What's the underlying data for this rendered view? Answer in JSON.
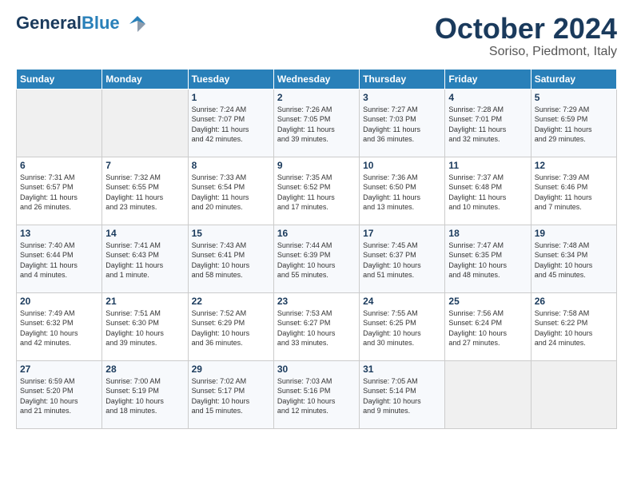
{
  "logo": {
    "line1": "General",
    "line2": "Blue"
  },
  "header": {
    "month": "October 2024",
    "location": "Soriso, Piedmont, Italy"
  },
  "weekdays": [
    "Sunday",
    "Monday",
    "Tuesday",
    "Wednesday",
    "Thursday",
    "Friday",
    "Saturday"
  ],
  "weeks": [
    [
      {
        "day": "",
        "content": ""
      },
      {
        "day": "",
        "content": ""
      },
      {
        "day": "1",
        "content": "Sunrise: 7:24 AM\nSunset: 7:07 PM\nDaylight: 11 hours\nand 42 minutes."
      },
      {
        "day": "2",
        "content": "Sunrise: 7:26 AM\nSunset: 7:05 PM\nDaylight: 11 hours\nand 39 minutes."
      },
      {
        "day": "3",
        "content": "Sunrise: 7:27 AM\nSunset: 7:03 PM\nDaylight: 11 hours\nand 36 minutes."
      },
      {
        "day": "4",
        "content": "Sunrise: 7:28 AM\nSunset: 7:01 PM\nDaylight: 11 hours\nand 32 minutes."
      },
      {
        "day": "5",
        "content": "Sunrise: 7:29 AM\nSunset: 6:59 PM\nDaylight: 11 hours\nand 29 minutes."
      }
    ],
    [
      {
        "day": "6",
        "content": "Sunrise: 7:31 AM\nSunset: 6:57 PM\nDaylight: 11 hours\nand 26 minutes."
      },
      {
        "day": "7",
        "content": "Sunrise: 7:32 AM\nSunset: 6:55 PM\nDaylight: 11 hours\nand 23 minutes."
      },
      {
        "day": "8",
        "content": "Sunrise: 7:33 AM\nSunset: 6:54 PM\nDaylight: 11 hours\nand 20 minutes."
      },
      {
        "day": "9",
        "content": "Sunrise: 7:35 AM\nSunset: 6:52 PM\nDaylight: 11 hours\nand 17 minutes."
      },
      {
        "day": "10",
        "content": "Sunrise: 7:36 AM\nSunset: 6:50 PM\nDaylight: 11 hours\nand 13 minutes."
      },
      {
        "day": "11",
        "content": "Sunrise: 7:37 AM\nSunset: 6:48 PM\nDaylight: 11 hours\nand 10 minutes."
      },
      {
        "day": "12",
        "content": "Sunrise: 7:39 AM\nSunset: 6:46 PM\nDaylight: 11 hours\nand 7 minutes."
      }
    ],
    [
      {
        "day": "13",
        "content": "Sunrise: 7:40 AM\nSunset: 6:44 PM\nDaylight: 11 hours\nand 4 minutes."
      },
      {
        "day": "14",
        "content": "Sunrise: 7:41 AM\nSunset: 6:43 PM\nDaylight: 11 hours\nand 1 minute."
      },
      {
        "day": "15",
        "content": "Sunrise: 7:43 AM\nSunset: 6:41 PM\nDaylight: 10 hours\nand 58 minutes."
      },
      {
        "day": "16",
        "content": "Sunrise: 7:44 AM\nSunset: 6:39 PM\nDaylight: 10 hours\nand 55 minutes."
      },
      {
        "day": "17",
        "content": "Sunrise: 7:45 AM\nSunset: 6:37 PM\nDaylight: 10 hours\nand 51 minutes."
      },
      {
        "day": "18",
        "content": "Sunrise: 7:47 AM\nSunset: 6:35 PM\nDaylight: 10 hours\nand 48 minutes."
      },
      {
        "day": "19",
        "content": "Sunrise: 7:48 AM\nSunset: 6:34 PM\nDaylight: 10 hours\nand 45 minutes."
      }
    ],
    [
      {
        "day": "20",
        "content": "Sunrise: 7:49 AM\nSunset: 6:32 PM\nDaylight: 10 hours\nand 42 minutes."
      },
      {
        "day": "21",
        "content": "Sunrise: 7:51 AM\nSunset: 6:30 PM\nDaylight: 10 hours\nand 39 minutes."
      },
      {
        "day": "22",
        "content": "Sunrise: 7:52 AM\nSunset: 6:29 PM\nDaylight: 10 hours\nand 36 minutes."
      },
      {
        "day": "23",
        "content": "Sunrise: 7:53 AM\nSunset: 6:27 PM\nDaylight: 10 hours\nand 33 minutes."
      },
      {
        "day": "24",
        "content": "Sunrise: 7:55 AM\nSunset: 6:25 PM\nDaylight: 10 hours\nand 30 minutes."
      },
      {
        "day": "25",
        "content": "Sunrise: 7:56 AM\nSunset: 6:24 PM\nDaylight: 10 hours\nand 27 minutes."
      },
      {
        "day": "26",
        "content": "Sunrise: 7:58 AM\nSunset: 6:22 PM\nDaylight: 10 hours\nand 24 minutes."
      }
    ],
    [
      {
        "day": "27",
        "content": "Sunrise: 6:59 AM\nSunset: 5:20 PM\nDaylight: 10 hours\nand 21 minutes."
      },
      {
        "day": "28",
        "content": "Sunrise: 7:00 AM\nSunset: 5:19 PM\nDaylight: 10 hours\nand 18 minutes."
      },
      {
        "day": "29",
        "content": "Sunrise: 7:02 AM\nSunset: 5:17 PM\nDaylight: 10 hours\nand 15 minutes."
      },
      {
        "day": "30",
        "content": "Sunrise: 7:03 AM\nSunset: 5:16 PM\nDaylight: 10 hours\nand 12 minutes."
      },
      {
        "day": "31",
        "content": "Sunrise: 7:05 AM\nSunset: 5:14 PM\nDaylight: 10 hours\nand 9 minutes."
      },
      {
        "day": "",
        "content": ""
      },
      {
        "day": "",
        "content": ""
      }
    ]
  ]
}
